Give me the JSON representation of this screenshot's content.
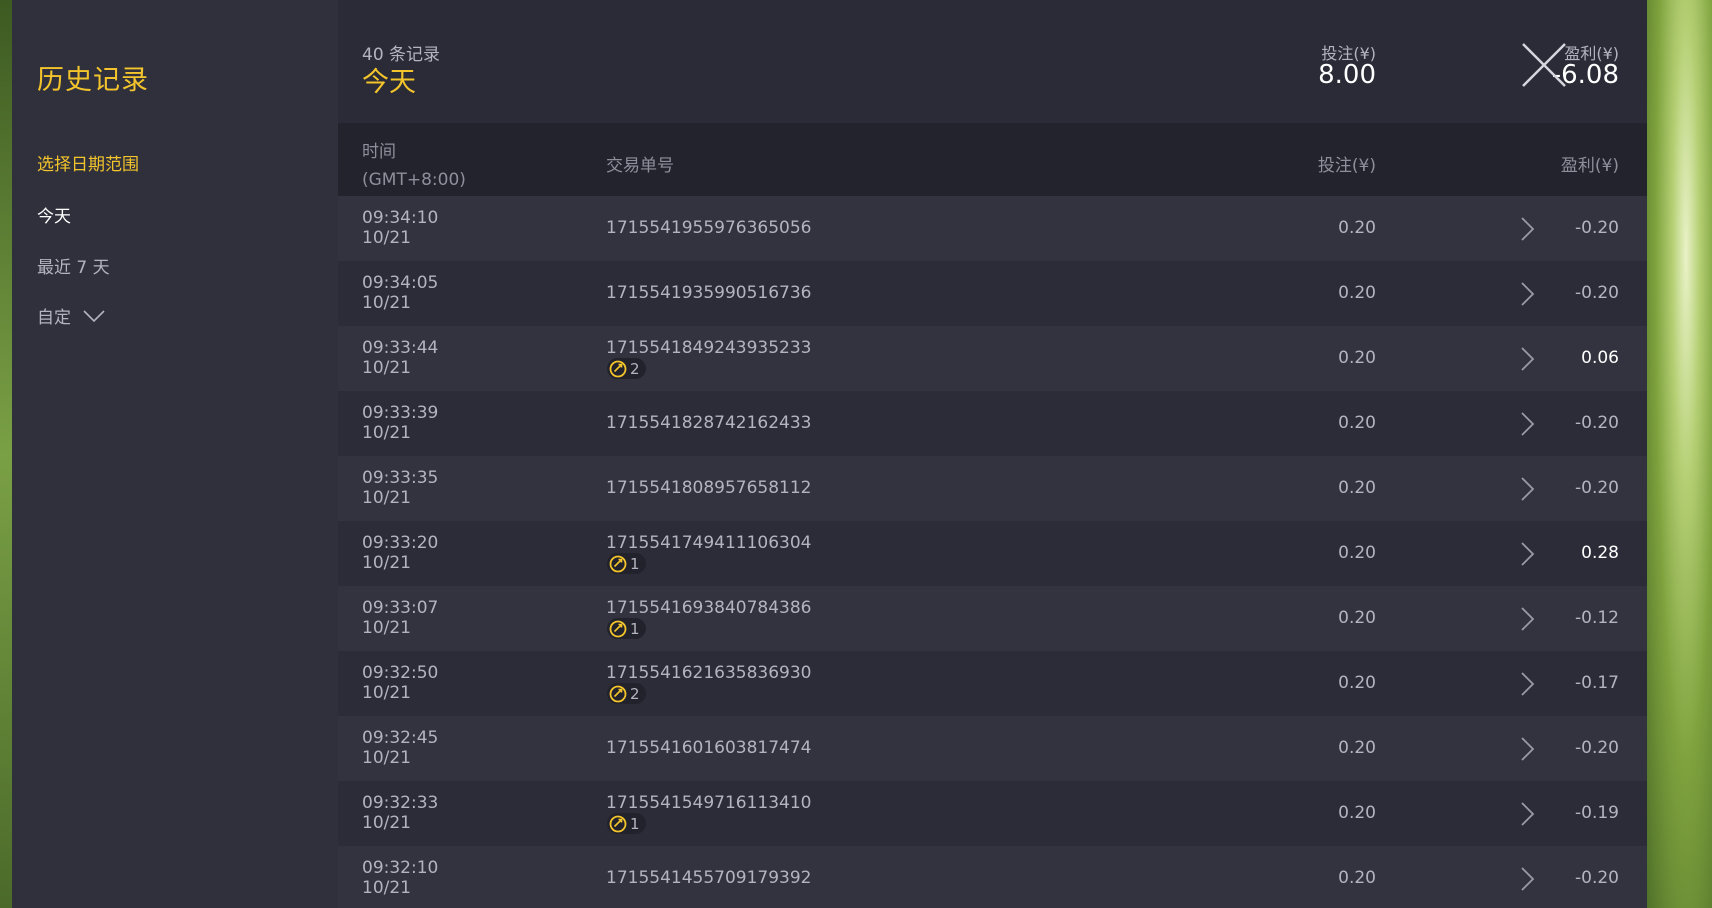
{
  "sidebar": {
    "title": "历史记录",
    "date_range_heading": "选择日期范围",
    "options": [
      {
        "label": "今天"
      },
      {
        "label": "最近 7 天"
      },
      {
        "label": "自定"
      }
    ]
  },
  "header": {
    "record_count": "40 条记录",
    "period": "今天",
    "bet_label": "投注(¥)",
    "bet_total": "8.00",
    "profit_label": "盈利(¥)",
    "profit_total": "-6.08"
  },
  "table": {
    "columns": {
      "time": "时间",
      "timezone": "(GMT+8:00)",
      "id": "交易单号",
      "bet": "投注(¥)",
      "profit": "盈利(¥)"
    },
    "rows": [
      {
        "time": "09:34:10",
        "date": "10/21",
        "id": "1715541955976365056",
        "badge": null,
        "bet": "0.20",
        "profit": "-0.20"
      },
      {
        "time": "09:34:05",
        "date": "10/21",
        "id": "1715541935990516736",
        "badge": null,
        "bet": "0.20",
        "profit": "-0.20"
      },
      {
        "time": "09:33:44",
        "date": "10/21",
        "id": "1715541849243935233",
        "badge": "2",
        "bet": "0.20",
        "profit": "0.06"
      },
      {
        "time": "09:33:39",
        "date": "10/21",
        "id": "1715541828742162433",
        "badge": null,
        "bet": "0.20",
        "profit": "-0.20"
      },
      {
        "time": "09:33:35",
        "date": "10/21",
        "id": "1715541808957658112",
        "badge": null,
        "bet": "0.20",
        "profit": "-0.20"
      },
      {
        "time": "09:33:20",
        "date": "10/21",
        "id": "1715541749411106304",
        "badge": "1",
        "bet": "0.20",
        "profit": "0.28"
      },
      {
        "time": "09:33:07",
        "date": "10/21",
        "id": "1715541693840784386",
        "badge": "1",
        "bet": "0.20",
        "profit": "-0.12"
      },
      {
        "time": "09:32:50",
        "date": "10/21",
        "id": "1715541621635836930",
        "badge": "2",
        "bet": "0.20",
        "profit": "-0.17"
      },
      {
        "time": "09:32:45",
        "date": "10/21",
        "id": "1715541601603817474",
        "badge": null,
        "bet": "0.20",
        "profit": "-0.20"
      },
      {
        "time": "09:32:33",
        "date": "10/21",
        "id": "1715541549716113410",
        "badge": "1",
        "bet": "0.20",
        "profit": "-0.19"
      },
      {
        "time": "09:32:10",
        "date": "10/21",
        "id": "1715541455709179392",
        "badge": null,
        "bet": "0.20",
        "profit": "-0.20"
      }
    ]
  },
  "colors": {
    "accent": "#f3c42b",
    "panel": "#2a2b36",
    "sidebar": "#2f303c",
    "positive_profit": "#ffffff"
  },
  "icons": {
    "close": "close-icon",
    "row_arrow": "chevron-right-icon",
    "dropdown": "chevron-down-icon",
    "badge": "free-spin-icon"
  }
}
